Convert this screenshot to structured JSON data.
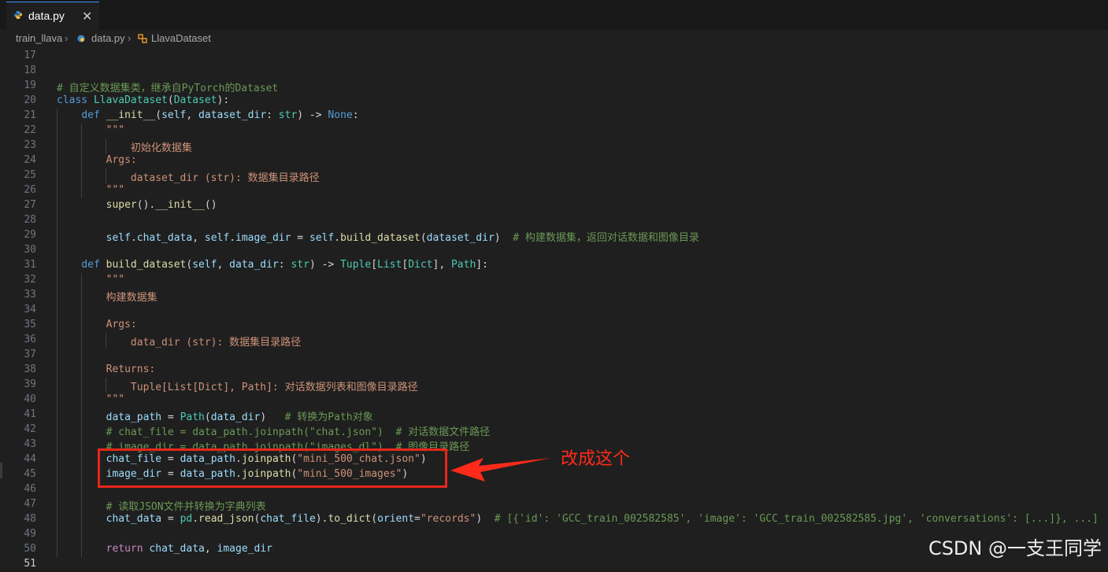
{
  "tab": {
    "name": "data.py",
    "close": "✕"
  },
  "breadcrumb": {
    "folder": "train_llava",
    "file": "data.py",
    "symbol": "LlavaDataset",
    "sep": "›"
  },
  "lines": [
    {
      "n": "17",
      "segs": []
    },
    {
      "n": "18",
      "segs": []
    },
    {
      "n": "19",
      "segs": [
        [
          "cm",
          "# 自定义数据集类，继承自PyTorch的Dataset"
        ]
      ]
    },
    {
      "n": "20",
      "segs": [
        [
          "kw",
          "class "
        ],
        [
          "cls",
          "LlavaDataset"
        ],
        [
          "plain",
          "("
        ],
        [
          "cls",
          "Dataset"
        ],
        [
          "plain",
          "):"
        ]
      ]
    },
    {
      "n": "21",
      "segs": [
        [
          "plain",
          "    "
        ],
        [
          "kw",
          "def "
        ],
        [
          "fn",
          "__init__"
        ],
        [
          "plain",
          "("
        ],
        [
          "par",
          "self"
        ],
        [
          "plain",
          ", "
        ],
        [
          "par",
          "dataset_dir"
        ],
        [
          "plain",
          ": "
        ],
        [
          "cls",
          "str"
        ],
        [
          "plain",
          ") -> "
        ],
        [
          "none",
          "None"
        ],
        [
          "plain",
          ":"
        ]
      ]
    },
    {
      "n": "22",
      "segs": [
        [
          "plain",
          "        "
        ],
        [
          "str",
          "\"\"\""
        ]
      ]
    },
    {
      "n": "23",
      "segs": [
        [
          "plain",
          "            "
        ],
        [
          "str",
          "初始化数据集"
        ]
      ]
    },
    {
      "n": "24",
      "segs": [
        [
          "plain",
          "        "
        ],
        [
          "str",
          "Args:"
        ]
      ]
    },
    {
      "n": "25",
      "segs": [
        [
          "plain",
          "            "
        ],
        [
          "str",
          "dataset_dir (str): 数据集目录路径"
        ]
      ]
    },
    {
      "n": "26",
      "segs": [
        [
          "plain",
          "        "
        ],
        [
          "str",
          "\"\"\""
        ]
      ]
    },
    {
      "n": "27",
      "segs": [
        [
          "plain",
          "        "
        ],
        [
          "fn",
          "super"
        ],
        [
          "plain",
          "()."
        ],
        [
          "fn",
          "__init__"
        ],
        [
          "plain",
          "()"
        ]
      ]
    },
    {
      "n": "28",
      "segs": []
    },
    {
      "n": "29",
      "segs": [
        [
          "plain",
          "        "
        ],
        [
          "par",
          "self"
        ],
        [
          "plain",
          "."
        ],
        [
          "par",
          "chat_data"
        ],
        [
          "plain",
          ", "
        ],
        [
          "par",
          "self"
        ],
        [
          "plain",
          "."
        ],
        [
          "par",
          "image_dir"
        ],
        [
          "plain",
          " = "
        ],
        [
          "par",
          "self"
        ],
        [
          "plain",
          "."
        ],
        [
          "fn",
          "build_dataset"
        ],
        [
          "plain",
          "("
        ],
        [
          "par",
          "dataset_dir"
        ],
        [
          "plain",
          ")  "
        ],
        [
          "cm",
          "# 构建数据集，返回对话数据和图像目录"
        ]
      ]
    },
    {
      "n": "30",
      "segs": []
    },
    {
      "n": "31",
      "segs": [
        [
          "plain",
          "    "
        ],
        [
          "kw",
          "def "
        ],
        [
          "fn",
          "build_dataset"
        ],
        [
          "plain",
          "("
        ],
        [
          "par",
          "self"
        ],
        [
          "plain",
          ", "
        ],
        [
          "par",
          "data_dir"
        ],
        [
          "plain",
          ": "
        ],
        [
          "cls",
          "str"
        ],
        [
          "plain",
          ") -> "
        ],
        [
          "cls",
          "Tuple"
        ],
        [
          "plain",
          "["
        ],
        [
          "cls",
          "List"
        ],
        [
          "plain",
          "["
        ],
        [
          "cls",
          "Dict"
        ],
        [
          "plain",
          "], "
        ],
        [
          "cls",
          "Path"
        ],
        [
          "plain",
          "]:"
        ]
      ]
    },
    {
      "n": "32",
      "segs": [
        [
          "plain",
          "        "
        ],
        [
          "str",
          "\"\"\""
        ]
      ]
    },
    {
      "n": "33",
      "segs": [
        [
          "plain",
          "        "
        ],
        [
          "str",
          "构建数据集"
        ]
      ]
    },
    {
      "n": "34",
      "segs": []
    },
    {
      "n": "35",
      "segs": [
        [
          "plain",
          "        "
        ],
        [
          "str",
          "Args:"
        ]
      ]
    },
    {
      "n": "36",
      "segs": [
        [
          "plain",
          "            "
        ],
        [
          "str",
          "data_dir (str): 数据集目录路径"
        ]
      ]
    },
    {
      "n": "37",
      "segs": []
    },
    {
      "n": "38",
      "segs": [
        [
          "plain",
          "        "
        ],
        [
          "str",
          "Returns:"
        ]
      ]
    },
    {
      "n": "39",
      "segs": [
        [
          "plain",
          "            "
        ],
        [
          "str",
          "Tuple[List[Dict], Path]: 对话数据列表和图像目录路径"
        ]
      ]
    },
    {
      "n": "40",
      "segs": [
        [
          "plain",
          "        "
        ],
        [
          "str",
          "\"\"\""
        ]
      ]
    },
    {
      "n": "41",
      "segs": [
        [
          "plain",
          "        "
        ],
        [
          "par",
          "data_path"
        ],
        [
          "plain",
          " = "
        ],
        [
          "cls",
          "Path"
        ],
        [
          "plain",
          "("
        ],
        [
          "par",
          "data_dir"
        ],
        [
          "plain",
          ")   "
        ],
        [
          "cm",
          "# 转换为Path对象"
        ]
      ]
    },
    {
      "n": "42",
      "segs": [
        [
          "plain",
          "        "
        ],
        [
          "cm",
          "# chat_file = data_path.joinpath(\"chat.json\")  # 对话数据文件路径"
        ]
      ]
    },
    {
      "n": "43",
      "segs": [
        [
          "plain",
          "        "
        ],
        [
          "cm",
          "# image_dir = data_path.joinpath(\"images_dl\")  # 图像目录路径"
        ]
      ]
    },
    {
      "n": "44",
      "segs": [
        [
          "plain",
          "        "
        ],
        [
          "par",
          "chat_file"
        ],
        [
          "plain",
          " = "
        ],
        [
          "par",
          "data_path"
        ],
        [
          "plain",
          "."
        ],
        [
          "fn",
          "joinpath"
        ],
        [
          "plain",
          "("
        ],
        [
          "str",
          "\"mini_500_chat.json\""
        ],
        [
          "plain",
          ")"
        ]
      ]
    },
    {
      "n": "45",
      "segs": [
        [
          "plain",
          "        "
        ],
        [
          "par",
          "image_dir"
        ],
        [
          "plain",
          " = "
        ],
        [
          "par",
          "data_path"
        ],
        [
          "plain",
          "."
        ],
        [
          "fn",
          "joinpath"
        ],
        [
          "plain",
          "("
        ],
        [
          "str",
          "\"mini_500_images\""
        ],
        [
          "plain",
          ")"
        ]
      ]
    },
    {
      "n": "46",
      "segs": []
    },
    {
      "n": "47",
      "segs": [
        [
          "plain",
          "        "
        ],
        [
          "cm",
          "# 读取JSON文件并转换为字典列表"
        ]
      ]
    },
    {
      "n": "48",
      "segs": [
        [
          "plain",
          "        "
        ],
        [
          "par",
          "chat_data"
        ],
        [
          "plain",
          " = "
        ],
        [
          "cls",
          "pd"
        ],
        [
          "plain",
          "."
        ],
        [
          "fn",
          "read_json"
        ],
        [
          "plain",
          "("
        ],
        [
          "par",
          "chat_file"
        ],
        [
          "plain",
          ")."
        ],
        [
          "fn",
          "to_dict"
        ],
        [
          "plain",
          "("
        ],
        [
          "par",
          "orient"
        ],
        [
          "plain",
          "="
        ],
        [
          "str",
          "\"records\""
        ],
        [
          "plain",
          ")  "
        ],
        [
          "cm",
          "# [{'id': 'GCC_train_002582585', 'image': 'GCC_train_002582585.jpg', 'conversations': [...]}, ...]"
        ]
      ]
    },
    {
      "n": "49",
      "segs": []
    },
    {
      "n": "50",
      "segs": [
        [
          "plain",
          "        "
        ],
        [
          "kw2",
          "return "
        ],
        [
          "par",
          "chat_data"
        ],
        [
          "plain",
          ", "
        ],
        [
          "par",
          "image_dir"
        ]
      ]
    },
    {
      "n": "51",
      "segs": []
    }
  ],
  "annotation": "改成这个",
  "watermark": "CSDN @一支王同学",
  "colors": {
    "accent": "#3794ff",
    "annotation_red": "#e8261a"
  }
}
